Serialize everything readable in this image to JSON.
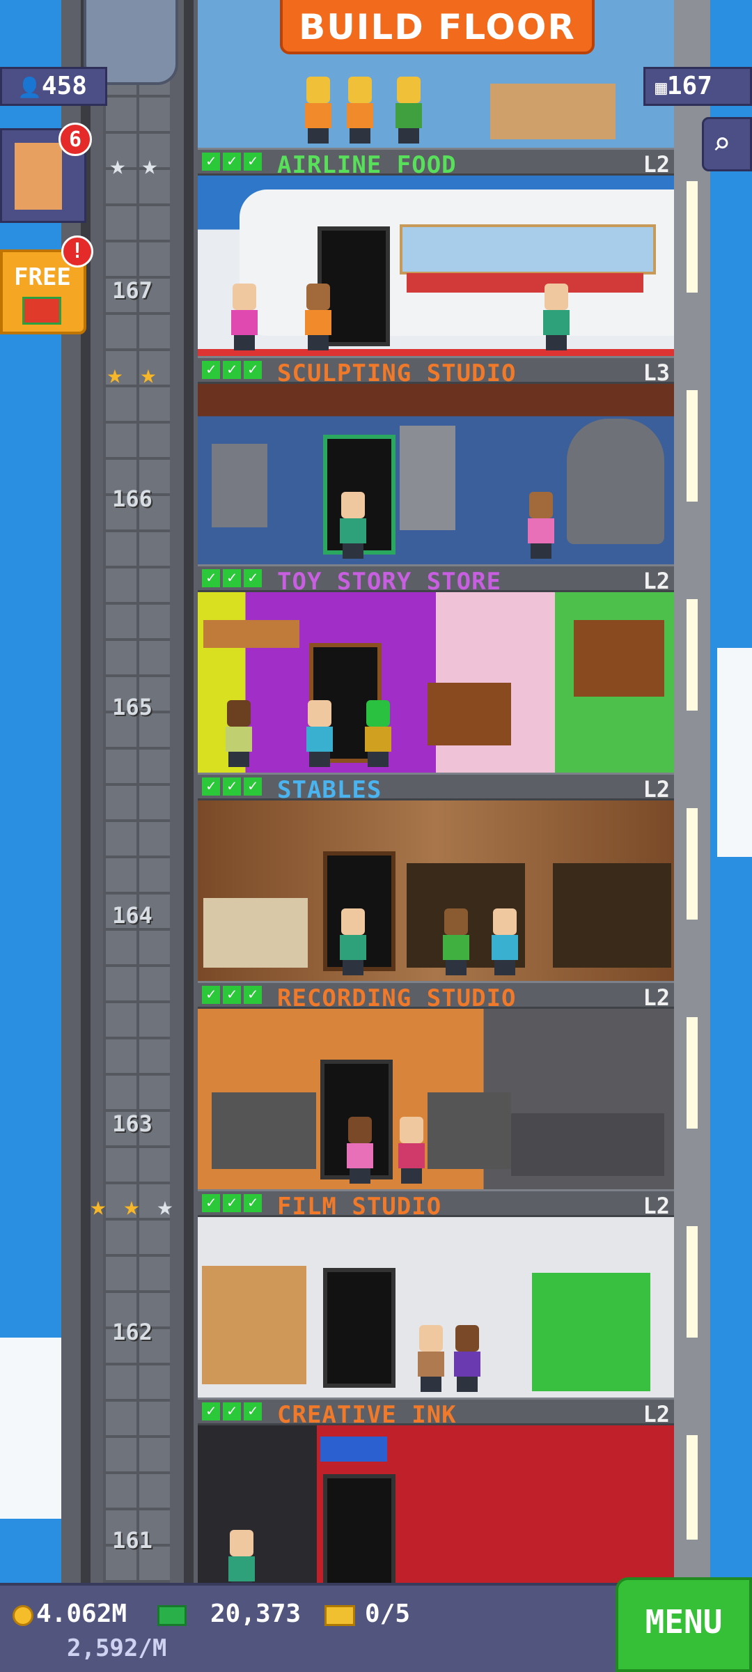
{
  "build": {
    "label": "BUILD FLOOR"
  },
  "hud": {
    "population": "458",
    "floors_count": "167",
    "notification_badge": "6",
    "free_label": "FREE",
    "free_badge": "!"
  },
  "floors": [
    {
      "number": "167",
      "name": "AIRLINE FOOD",
      "level": "L2",
      "name_color": "#58e05a",
      "stars": [
        "silver",
        "silver"
      ]
    },
    {
      "number": "166",
      "name": "SCULPTING STUDIO",
      "level": "L3",
      "name_color": "#f07a2a",
      "stars": [
        "gold",
        "gold"
      ]
    },
    {
      "number": "165",
      "name": "TOY STORY STORE",
      "level": "L2",
      "name_color": "#c85ee0",
      "stars": []
    },
    {
      "number": "164",
      "name": "STABLES",
      "level": "L2",
      "name_color": "#4ab4f0",
      "stars": []
    },
    {
      "number": "163",
      "name": "RECORDING STUDIO",
      "level": "L2",
      "name_color": "#f07a2a",
      "stars": []
    },
    {
      "number": "162",
      "name": "FILM STUDIO",
      "level": "L2",
      "name_color": "#f07a2a",
      "stars": [
        "gold",
        "gold",
        "silver"
      ]
    },
    {
      "number": "161",
      "name": "CREATIVE INK",
      "level": "L2",
      "name_color": "#f07a2a",
      "stars": []
    }
  ],
  "bottom": {
    "coins": "4.062M",
    "bux": "20,373",
    "tickets": "0/5",
    "income_rate": "2,592/M",
    "menu_label": "MENU"
  },
  "colors": {
    "sky": "#2a8fe0",
    "menu_green": "#36c037",
    "build_orange": "#f26b1c"
  },
  "icons": [
    "person-icon",
    "building-icon",
    "search-icon",
    "gift-icon",
    "coin-icon",
    "bux-icon",
    "ticket-icon",
    "check-icon",
    "star-icon"
  ]
}
